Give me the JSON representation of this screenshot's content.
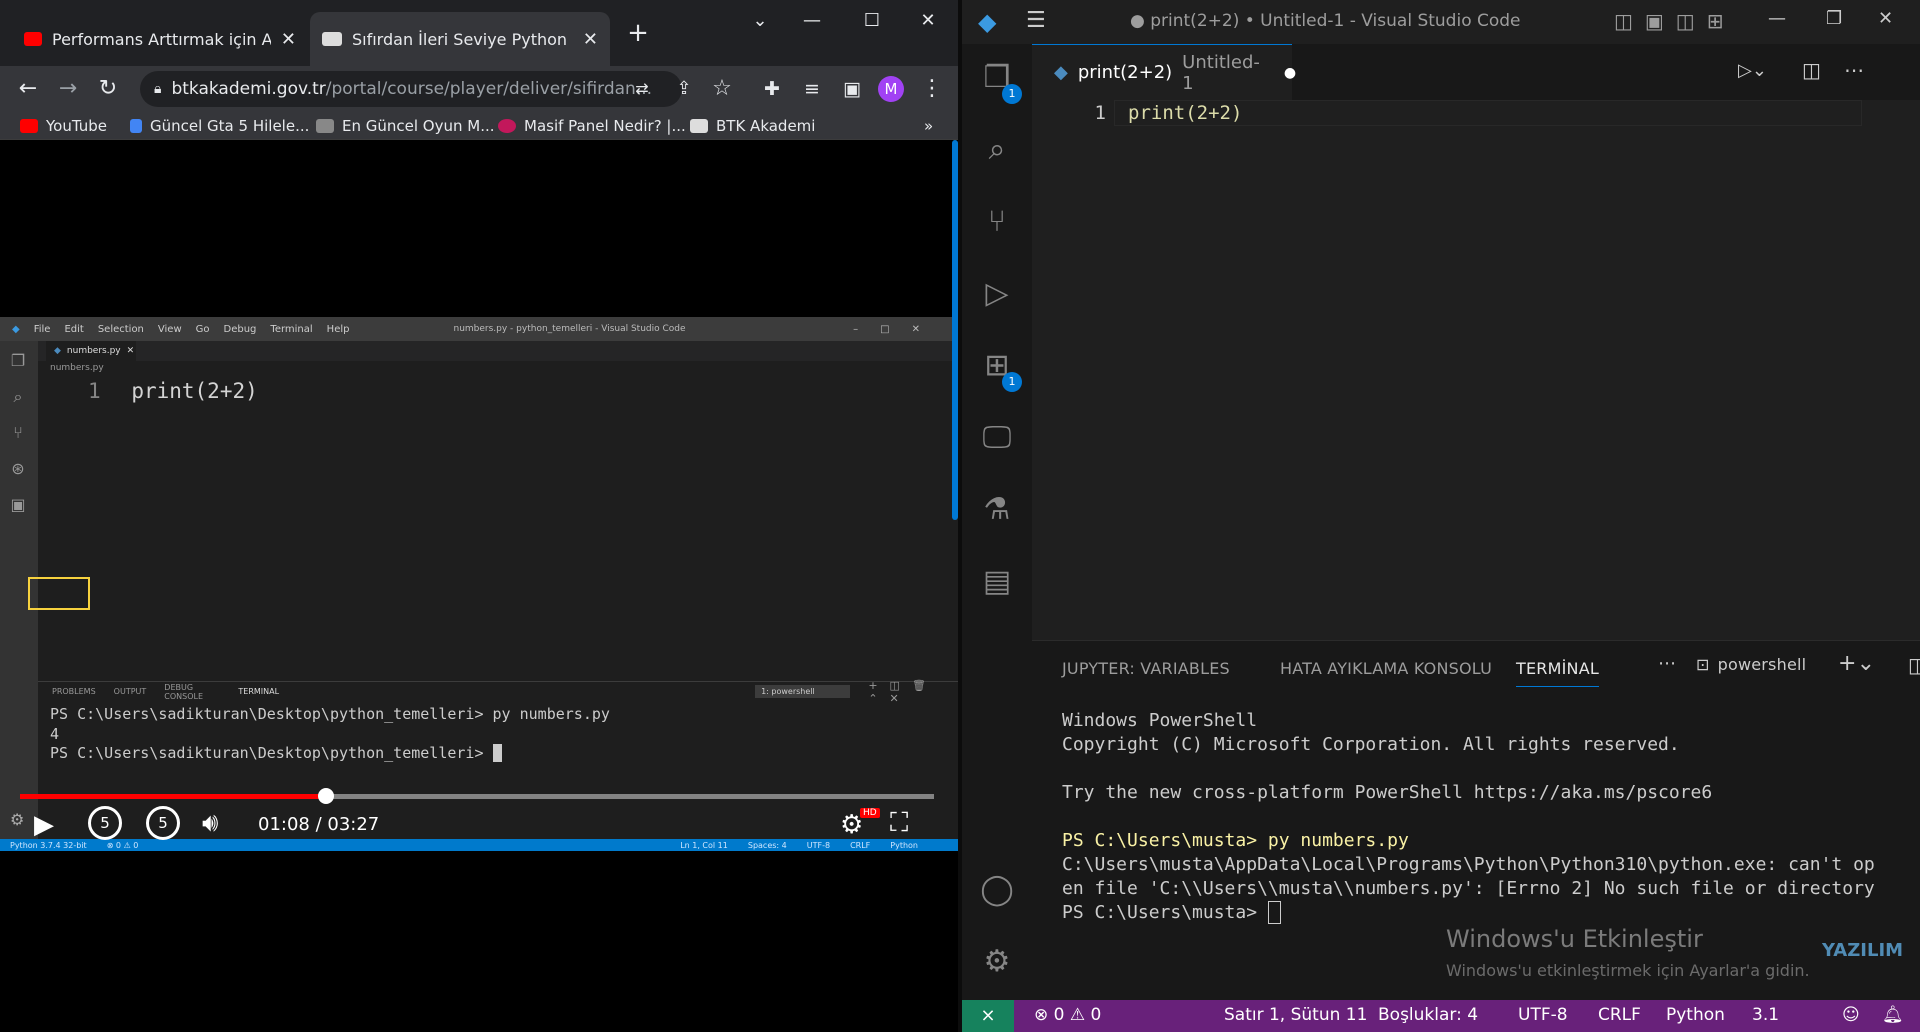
{
  "chrome": {
    "tabs": [
      {
        "title": "Performans Arttırmak için Araç Ya",
        "favicon_color": "#ff0000"
      },
      {
        "title": "Sıfırdan İleri Seviye Python Progr",
        "favicon_color": "#dddddd"
      }
    ],
    "new_tab": "+",
    "url_host": "btkakademi.gov.tr",
    "url_path": "/portal/course/player/deliver/sifirdan...",
    "profile_initial": "M",
    "bookmarks": [
      "YouTube",
      "Güncel Gta 5 Hilele...",
      "En Güncel Oyun M...",
      "Masif Panel Nedir? |...",
      "BTK Akademi"
    ],
    "bookmarks_more": "»"
  },
  "video": {
    "inner_vscode": {
      "menu": [
        "File",
        "Edit",
        "Selection",
        "View",
        "Go",
        "Debug",
        "Terminal",
        "Help"
      ],
      "title": "numbers.py - python_temelleri - Visual Studio Code",
      "tab": "numbers.py",
      "breadcrumb": "numbers.py",
      "line_number": "1",
      "code": "print(2+2)",
      "panel_tabs": [
        "PROBLEMS",
        "OUTPUT",
        "DEBUG CONSOLE",
        "TERMINAL"
      ],
      "shell_select": "1: powershell",
      "terminal_lines": [
        "PS C:\\Users\\sadikturan\\Desktop\\python_temelleri> py numbers.py",
        "4",
        "PS C:\\Users\\sadikturan\\Desktop\\python_temelleri> "
      ],
      "status_left": [
        "Python 3.7.4 32-bit",
        "⊗ 0 ⚠ 0"
      ],
      "status_right": [
        "Ln 1, Col 11",
        "Spaces: 4",
        "UTF-8",
        "CRLF",
        "Python"
      ]
    },
    "progress_fraction": 0.335,
    "time": "01:08 / 03:27",
    "skip_back": "5",
    "skip_forward": "5",
    "hd_badge": "HD"
  },
  "vscode": {
    "title": "● print(2+2) • Untitled-1 - Visual Studio Code",
    "activity_badges": [
      "1",
      "1"
    ],
    "tab_title": "print(2+2)",
    "tab_sub": "Untitled-1",
    "line_number": "1",
    "code": "print(2+2)",
    "panel_tabs": [
      "JUPYTER: VARIABLES",
      "HATA AYIKLAMA KONSOLU",
      "TERMİNAL"
    ],
    "shell": "powershell",
    "terminal_lines": [
      "Windows PowerShell",
      "Copyright (C) Microsoft Corporation. All rights reserved.",
      "",
      "Try the new cross-platform PowerShell https://aka.ms/pscore6",
      "",
      "PS C:\\Users\\musta> py numbers.py",
      "C:\\Users\\musta\\AppData\\Local\\Programs\\Python\\Python310\\python.exe: can't op",
      "en file 'C:\\\\Users\\\\musta\\\\numbers.py': [Errno 2] No such file or directory",
      "PS C:\\Users\\musta> "
    ],
    "activation_title": "Windows'u Etkinleştir",
    "activation_sub": "Windows'u etkinleştirmek için Ayarlar'a gidin.",
    "status": {
      "problems": "⊗ 0 ⚠ 0",
      "position": "Satır 1, Sütun 11",
      "spaces": "Boşluklar: 4",
      "encoding": "UTF-8",
      "eol": "CRLF",
      "language": "Python",
      "version": "3.1"
    },
    "logo_text": "YAZILIM"
  }
}
